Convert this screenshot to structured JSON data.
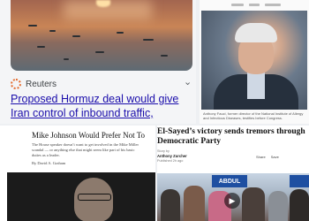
{
  "reuters_card": {
    "publisher": "Reuters",
    "headline": "Proposed Hormuz deal would give Iran control of inbound traffic, sources say",
    "more_icon": "chevron-down-icon"
  },
  "fauci_card": {
    "caption": "Anthony Fauci, former director of the National Institute of Allergy and Infectious Diseases, testifies before Congress."
  },
  "johnson_card": {
    "title": "Mike Johnson Would Prefer Not To",
    "dek": "The House speaker doesn’t want to get involved in the Mike Miller scandal — or anything else that might seem like part of his basic duties as a leader.",
    "byline": "By David A. Graham"
  },
  "elsayed_card": {
    "title": "El-Sayed’s victory sends tremors through Democratic Party",
    "byline_label": "Story by",
    "byline": "Anthony Zurcher",
    "date": "Published 2h ago",
    "actions": [
      "Share",
      "Save"
    ],
    "sign_text": "ABDUL"
  },
  "colors": {
    "link": "#1a0dab",
    "reuters_orange": "#e46b2d"
  }
}
